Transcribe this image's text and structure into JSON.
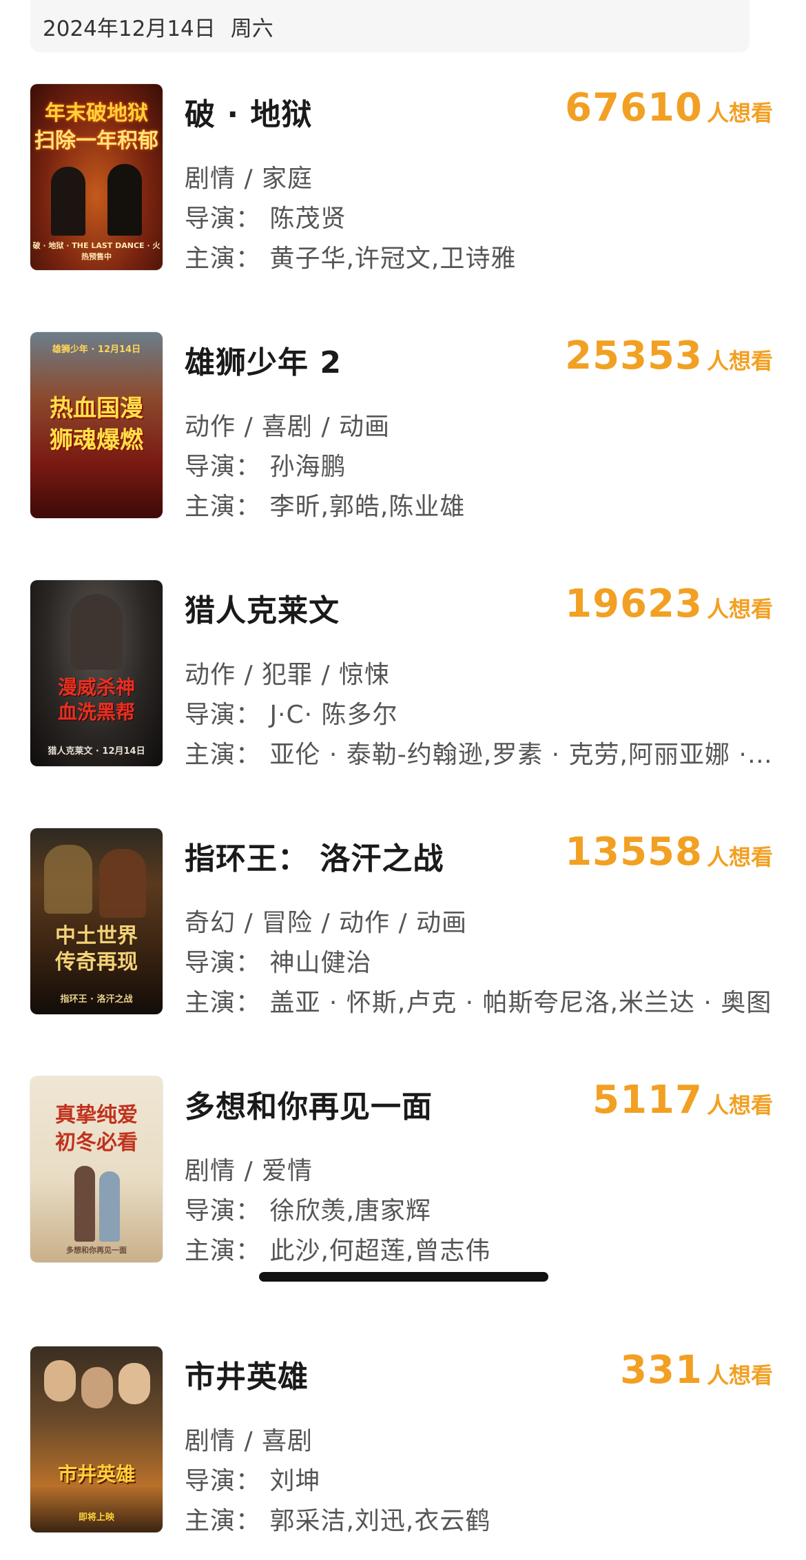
{
  "header": {
    "date": "2024年12月14日",
    "weekday": "周六"
  },
  "want_suffix": "人想看",
  "movies": [
    {
      "title": "破 · 地狱",
      "want_count": "67610",
      "genre": "剧情 / 家庭",
      "director": "导演：  陈茂贤",
      "actors": "主演：  黄子华,许冠文,卫诗雅",
      "poster_text": [
        "年末破地狱",
        "扫除一年积郁"
      ],
      "poster_sub": "破 · 地狱 · THE LAST DANCE · 火热预售中"
    },
    {
      "title": "雄狮少年 2",
      "want_count": "25353",
      "genre": "动作 / 喜剧 / 动画",
      "director": "导演：  孙海鹏",
      "actors": "主演：  李昕,郭皓,陈业雄",
      "poster_text": [
        "热血国漫",
        "狮魂爆燃"
      ],
      "poster_sub": "雄狮少年 · 12月14日"
    },
    {
      "title": "猎人克莱文",
      "want_count": "19623",
      "genre": "动作 / 犯罪 / 惊悚",
      "director": "导演：  J·C· 陈多尔",
      "actors": "主演：  亚伦 · 泰勒-约翰逊,罗素 · 克劳,阿丽亚娜 · 德博斯",
      "poster_text": [
        "漫威杀神",
        "血洗黑帮"
      ],
      "poster_sub": "猎人克莱文 · 12月14日"
    },
    {
      "title": "指环王：  洛汗之战",
      "want_count": "13558",
      "genre": "奇幻 / 冒险 / 动作 / 动画",
      "director": "导演：  神山健治",
      "actors": "主演：  盖亚 · 怀斯,卢克 · 帕斯夸尼洛,米兰达 · 奥图",
      "poster_text": [
        "中土世界",
        "传奇再现"
      ],
      "poster_sub": "指环王 · 洛汗之战"
    },
    {
      "title": "多想和你再见一面",
      "want_count": "5117",
      "genre": "剧情 / 爱情",
      "director": "导演：  徐欣羡,唐家辉",
      "actors": "主演：  此沙,何超莲,曾志伟",
      "poster_text": [
        "真挚纯爱",
        "初冬必看"
      ],
      "poster_sub": "多想和你再见一面"
    },
    {
      "title": "市井英雄",
      "want_count": "331",
      "genre": "剧情 / 喜剧",
      "director": "导演：  刘坤",
      "actors": "主演：  郭采洁,刘迅,衣云鹤",
      "poster_text": [
        "市井英雄"
      ],
      "poster_sub": "即将上映"
    }
  ],
  "colors": {
    "accent": "#f2a023",
    "title": "#1a1a1a",
    "info": "#555555"
  }
}
